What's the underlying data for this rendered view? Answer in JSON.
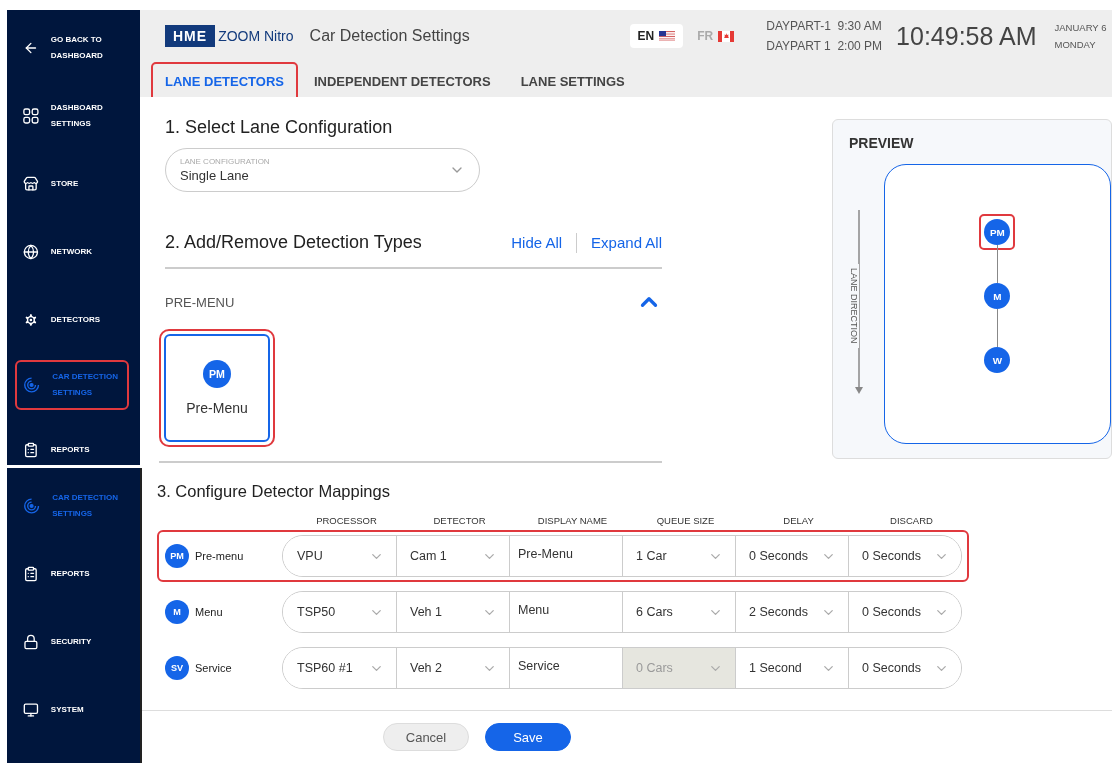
{
  "top_panel": {
    "sidebar": {
      "items": [
        {
          "kind": "back",
          "label": "GO BACK TO DASHBOARD",
          "selected": false,
          "highlighted": false
        },
        {
          "kind": "dashboard",
          "label": "DASHBOARD SETTINGS",
          "selected": false,
          "highlighted": false
        },
        {
          "kind": "store",
          "label": "STORE",
          "selected": false,
          "highlighted": false
        },
        {
          "kind": "network",
          "label": "NETWORK",
          "selected": false,
          "highlighted": false
        },
        {
          "kind": "detectors",
          "label": "DETECTORS",
          "selected": false,
          "highlighted": false
        },
        {
          "kind": "car_detection",
          "label": "CAR DETECTION SETTINGS",
          "selected": true,
          "highlighted": true
        },
        {
          "kind": "reports",
          "label": "REPORTS",
          "selected": false,
          "highlighted": false
        }
      ]
    },
    "header": {
      "logo_mark": "HME",
      "logo_text": "ZOOM Nitro",
      "title": "Car Detection Settings",
      "languages": [
        {
          "code": "EN",
          "kind": "us",
          "selected": true
        },
        {
          "code": "FR",
          "kind": "ca",
          "selected": false
        }
      ],
      "dayparts": [
        {
          "name": "DAYPART-1",
          "time": "9:30 AM"
        },
        {
          "name": "DAYPART 1",
          "time": "2:00 PM"
        }
      ],
      "clock": "10:49:58 AM",
      "date": "JANUARY 6",
      "weekday": "MONDAY"
    },
    "tabs": [
      {
        "label": "LANE DETECTORS",
        "selected": true,
        "highlighted": true
      },
      {
        "label": "INDEPENDENT DETECTORS",
        "selected": false,
        "highlighted": false
      },
      {
        "label": "LANE SETTINGS",
        "selected": false,
        "highlighted": false
      }
    ],
    "lane_configuration": {
      "heading": "1. Select Lane Configuration",
      "field_label": "LANE CONFIGURATION",
      "value": "Single Lane"
    },
    "detection_types": {
      "heading": "2. Add/Remove Detection Types",
      "hide_all": "Hide All",
      "expand_all": "Expand All",
      "groups": [
        {
          "title": "PRE-MENU",
          "expanded": true,
          "cards": [
            {
              "badge": "PM",
              "label": "Pre-Menu",
              "selected": true,
              "highlighted": true
            }
          ]
        }
      ]
    },
    "preview": {
      "title": "PREVIEW",
      "direction_label": "LANE DIRECTION",
      "nodes": [
        {
          "badge": "PM",
          "highlighted": true
        },
        {
          "badge": "M",
          "highlighted": false
        },
        {
          "badge": "W",
          "highlighted": false
        }
      ]
    }
  },
  "bottom_panel": {
    "sidebar": {
      "items": [
        {
          "kind": "car_detection",
          "label": "CAR DETECTION SETTINGS",
          "selected": true,
          "highlighted": false
        },
        {
          "kind": "reports",
          "label": "REPORTS",
          "selected": false,
          "highlighted": false
        },
        {
          "kind": "security",
          "label": "SECURITY",
          "selected": false,
          "highlighted": false
        },
        {
          "kind": "system",
          "label": "SYSTEM",
          "selected": false,
          "highlighted": false
        }
      ]
    },
    "mappings": {
      "heading": "3. Configure Detector Mappings",
      "columns": [
        "PROCESSOR",
        "DETECTOR",
        "DISPLAY NAME",
        "QUEUE SIZE",
        "DELAY",
        "DISCARD"
      ],
      "rows": [
        {
          "badge": "PM",
          "name": "Pre-menu",
          "highlighted": true,
          "cells": [
            {
              "kind": "select",
              "value": "VPU",
              "disabled": false
            },
            {
              "kind": "select",
              "value": "Cam 1",
              "disabled": false
            },
            {
              "kind": "input",
              "value": "Pre-Menu",
              "disabled": false
            },
            {
              "kind": "select",
              "value": "1 Car",
              "disabled": false
            },
            {
              "kind": "select",
              "value": "0 Seconds",
              "disabled": false
            },
            {
              "kind": "select",
              "value": "0 Seconds",
              "disabled": false
            }
          ]
        },
        {
          "badge": "M",
          "name": "Menu",
          "highlighted": false,
          "cells": [
            {
              "kind": "select",
              "value": "TSP50",
              "disabled": false
            },
            {
              "kind": "select",
              "value": "Veh 1",
              "disabled": false
            },
            {
              "kind": "input",
              "value": "Menu",
              "disabled": false
            },
            {
              "kind": "select",
              "value": "6 Cars",
              "disabled": false
            },
            {
              "kind": "select",
              "value": "2 Seconds",
              "disabled": false
            },
            {
              "kind": "select",
              "value": "0 Seconds",
              "disabled": false
            }
          ]
        },
        {
          "badge": "SV",
          "name": "Service",
          "highlighted": false,
          "cells": [
            {
              "kind": "select",
              "value": "TSP60 #1",
              "disabled": false
            },
            {
              "kind": "select",
              "value": "Veh 2",
              "disabled": false
            },
            {
              "kind": "input",
              "value": "Service",
              "disabled": false
            },
            {
              "kind": "select",
              "value": "0 Cars",
              "disabled": true
            },
            {
              "kind": "select",
              "value": "1 Second",
              "disabled": false
            },
            {
              "kind": "select",
              "value": "0 Seconds",
              "disabled": false
            }
          ]
        }
      ]
    },
    "buttons": [
      {
        "label": "Cancel",
        "kind": "secondary"
      },
      {
        "label": "Save",
        "kind": "primary"
      }
    ]
  }
}
